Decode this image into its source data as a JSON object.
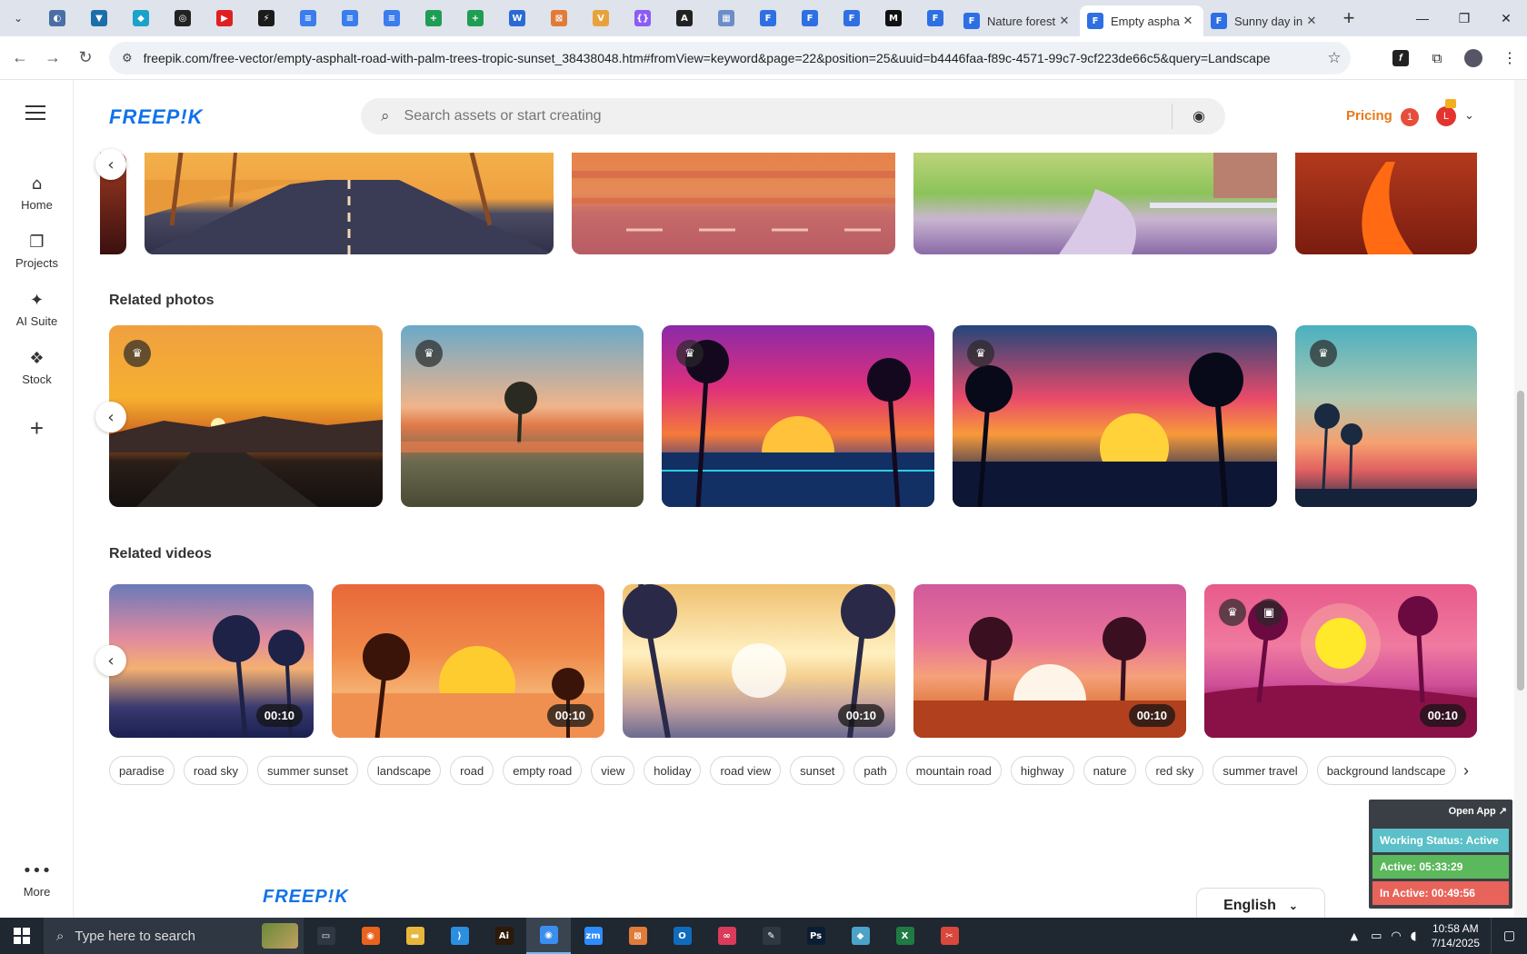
{
  "browser": {
    "tabs": [
      {
        "title": "Nature forest",
        "active": false
      },
      {
        "title": "Empty asphalt",
        "active": true
      },
      {
        "title": "Sunny day in",
        "active": false
      }
    ],
    "pinned_icons": [
      {
        "name": "globe-icon",
        "color": "#4a6fa5",
        "glyph": "◐"
      },
      {
        "name": "vpn-icon",
        "color": "#1b6fa8",
        "glyph": "▼"
      },
      {
        "name": "edge-ext-icon",
        "color": "#1aa3c9",
        "glyph": "◆"
      },
      {
        "name": "openai-icon",
        "color": "#222222",
        "glyph": "◎"
      },
      {
        "name": "youtube-icon",
        "color": "#e02020",
        "glyph": "▶"
      },
      {
        "name": "bolt-icon",
        "color": "#1b1b1b",
        "glyph": "⚡"
      },
      {
        "name": "docs-icon-1",
        "color": "#3b7ded",
        "glyph": "≡"
      },
      {
        "name": "docs-icon-2",
        "color": "#3b7ded",
        "glyph": "≡"
      },
      {
        "name": "docs-icon-3",
        "color": "#3b7ded",
        "glyph": "≡"
      },
      {
        "name": "sheets-icon-1",
        "color": "#1f9d55",
        "glyph": "+"
      },
      {
        "name": "sheets-icon-2",
        "color": "#1f9d55",
        "glyph": "+"
      },
      {
        "name": "word-icon",
        "color": "#2b6ad6",
        "glyph": "W"
      },
      {
        "name": "toolbox-icon",
        "color": "#e07b39",
        "glyph": "⊠"
      },
      {
        "name": "vee-icon",
        "color": "#e8a23c",
        "glyph": "V"
      },
      {
        "name": "code-braces-icon",
        "color": "#8b5cf6",
        "glyph": "{}"
      },
      {
        "name": "arc-icon",
        "color": "#222222",
        "glyph": "A"
      },
      {
        "name": "grid-app-icon",
        "color": "#6b8ec9",
        "glyph": "▦"
      },
      {
        "name": "forms-icon-1",
        "color": "#2f6fe4",
        "glyph": "F"
      },
      {
        "name": "forms-icon-2",
        "color": "#2f6fe4",
        "glyph": "F"
      },
      {
        "name": "forms-icon-3",
        "color": "#2f6fe4",
        "glyph": "F"
      },
      {
        "name": "medium-icon",
        "color": "#111111",
        "glyph": "M"
      },
      {
        "name": "forms-icon-4",
        "color": "#2f6fe4",
        "glyph": "F"
      }
    ],
    "url": "freepik.com/free-vector/empty-asphalt-road-with-palm-trees-tropic-sunset_38438048.htm#fromView=keyword&page=22&position=25&uuid=b4446faa-f89c-4571-99c7-9cf223de66c5&query=Landscape"
  },
  "sidebar": {
    "items": [
      {
        "label": "Home",
        "icon": "home-icon",
        "glyph": "⌂"
      },
      {
        "label": "Projects",
        "icon": "projects-icon",
        "glyph": "❐"
      },
      {
        "label": "AI Suite",
        "icon": "sparkle-icon",
        "glyph": "✦"
      },
      {
        "label": "Stock",
        "icon": "stock-icon",
        "glyph": "❖"
      }
    ],
    "more_label": "More"
  },
  "header": {
    "brand": "FREEP!K",
    "search_placeholder": "Search assets or start creating",
    "pricing": "Pricing",
    "notification_count": "1",
    "avatar_initial": "L"
  },
  "sections": {
    "related_photos_title": "Related photos",
    "related_videos_title": "Related videos"
  },
  "videos": [
    {
      "duration": "00:10"
    },
    {
      "duration": "00:10"
    },
    {
      "duration": "00:10"
    },
    {
      "duration": "00:10"
    },
    {
      "duration": "00:10"
    }
  ],
  "tags": [
    "paradise",
    "road sky",
    "summer sunset",
    "landscape",
    "road",
    "empty road",
    "view",
    "holiday",
    "road view",
    "sunset",
    "path",
    "mountain road",
    "highway",
    "nature",
    "red sky",
    "summer travel",
    "background landscape"
  ],
  "footer": {
    "brand": "FREEP!K",
    "language": "English"
  },
  "tracker": {
    "open_app": "Open App ↗",
    "working_status": "Working Status: Active",
    "active": "Active: 05:33:29",
    "inactive": "In Active: 00:49:56",
    "colors": {
      "working": "#5bc0c8",
      "active": "#5cb85c",
      "inactive": "#e8645a"
    }
  },
  "taskbar": {
    "search_placeholder": "Type here to search",
    "apps": [
      {
        "name": "task-view-icon",
        "color": "#2f3742",
        "glyph": "▭"
      },
      {
        "name": "firefox-icon",
        "color": "#e8631c",
        "glyph": "◉"
      },
      {
        "name": "file-explorer-icon",
        "color": "#e8b83c",
        "glyph": "▬"
      },
      {
        "name": "vscode-icon",
        "color": "#2b8fe0",
        "glyph": "⟩"
      },
      {
        "name": "illustrator-icon",
        "color": "#2c1a08",
        "glyph": "Ai"
      },
      {
        "name": "chrome-icon",
        "color": "#3a8ef0",
        "glyph": "◉"
      },
      {
        "name": "zoom-icon",
        "color": "#2d8cff",
        "glyph": "zm"
      },
      {
        "name": "toolbox-icon",
        "color": "#e07b39",
        "glyph": "⊠"
      },
      {
        "name": "outlook-icon",
        "color": "#0f6cbd",
        "glyph": "O"
      },
      {
        "name": "creative-cloud-icon",
        "color": "#da3b5c",
        "glyph": "∞"
      },
      {
        "name": "pen-tool-icon",
        "color": "#2f3742",
        "glyph": "✎"
      },
      {
        "name": "photoshop-icon",
        "color": "#0b1d33",
        "glyph": "Ps"
      },
      {
        "name": "gem-app-icon",
        "color": "#4ba3c7",
        "glyph": "◆"
      },
      {
        "name": "excel-icon",
        "color": "#1f7a44",
        "glyph": "X"
      },
      {
        "name": "snip-icon",
        "color": "#d9483b",
        "glyph": "✂"
      }
    ],
    "time": "10:58 AM",
    "date": "7/14/2025"
  }
}
